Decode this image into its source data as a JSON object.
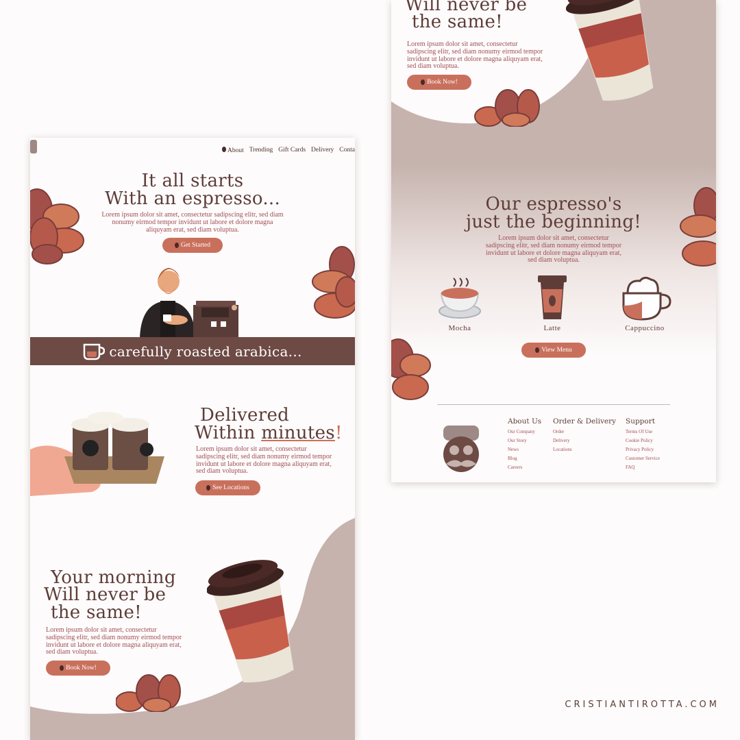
{
  "nav": {
    "links": [
      "About",
      "Trending",
      "Gift Cards",
      "Delivery",
      "Conta"
    ]
  },
  "hero": {
    "title_line1": "It all starts",
    "title_line2": "With an espresso...",
    "lorem": "Lorem ipsum dolor sit amet, consectetur sadipscing elitr, sed diam nonumy eirmod tempor invidunt ut labore et dolore magna aliquyam erat, sed diam voluptua.",
    "cta": "Get Started"
  },
  "band": {
    "text": "carefully roasted arabica..."
  },
  "delivery": {
    "title_line1": "Delivered",
    "title_line2a": "Within ",
    "title_line2b": "minutes",
    "title_line2c": "!",
    "lorem": "Lorem ipsum dolor sit amet, consectetur sadipscing elitr, sed diam nonumy eirmod tempor invidunt ut labore et dolore magna aliquyam erat, sed diam voluptua.",
    "cta": "See Locations"
  },
  "morning": {
    "title_line1": "Your morning",
    "title_line2": "Will never be",
    "title_line3": "the same!",
    "lorem": "Lorem ipsum dolor sit amet, consectetur sadipscing elitr, sed diam nonumy eirmod tempor invidunt ut labore et dolore magna aliquyam erat, sed diam voluptua.",
    "cta": "Book Now!"
  },
  "right_top": {
    "title_line2": "Will never be",
    "title_line3": "the same!",
    "lorem": "Lorem ipsum dolor sit amet, consectetur sadipscing elitr, sed diam nonumy eirmod tempor invidunt ut labore et dolore magna aliquyam erat, sed diam voluptua.",
    "cta": "Book Now!"
  },
  "menu": {
    "title_line1": "Our espresso's",
    "title_line2": "just the beginning!",
    "lorem": "Lorem ipsum dolor sit amet, consectetur sadipscing elitr, sed diam nonumy eirmod tempor invidunt ut labore et dolore magna aliquyam erat, sed diam voluptua.",
    "items": [
      "Mocha",
      "Latte",
      "Cappuccino"
    ],
    "cta": "View Menu"
  },
  "footer": {
    "col1": {
      "heading": "About Us",
      "links": [
        "Our Company",
        "Our Story",
        "News",
        "Blog",
        "Careers"
      ]
    },
    "col2": {
      "heading": "Order & Delivery",
      "links": [
        "Order",
        "Delivery",
        "Locations"
      ]
    },
    "col3": {
      "heading": "Support",
      "links": [
        "Terms Of Use",
        "Cookie Policy",
        "Privacy Policy",
        "Customer Service",
        "FAQ"
      ]
    }
  },
  "watermark": "CRISTIANTIROTTA.COM",
  "colors": {
    "brown_dark": "#5e3d38",
    "band": "#6e4a45",
    "accent": "#c9705d",
    "taupe": "#c6b3ae",
    "text_rose": "#a04e56"
  }
}
